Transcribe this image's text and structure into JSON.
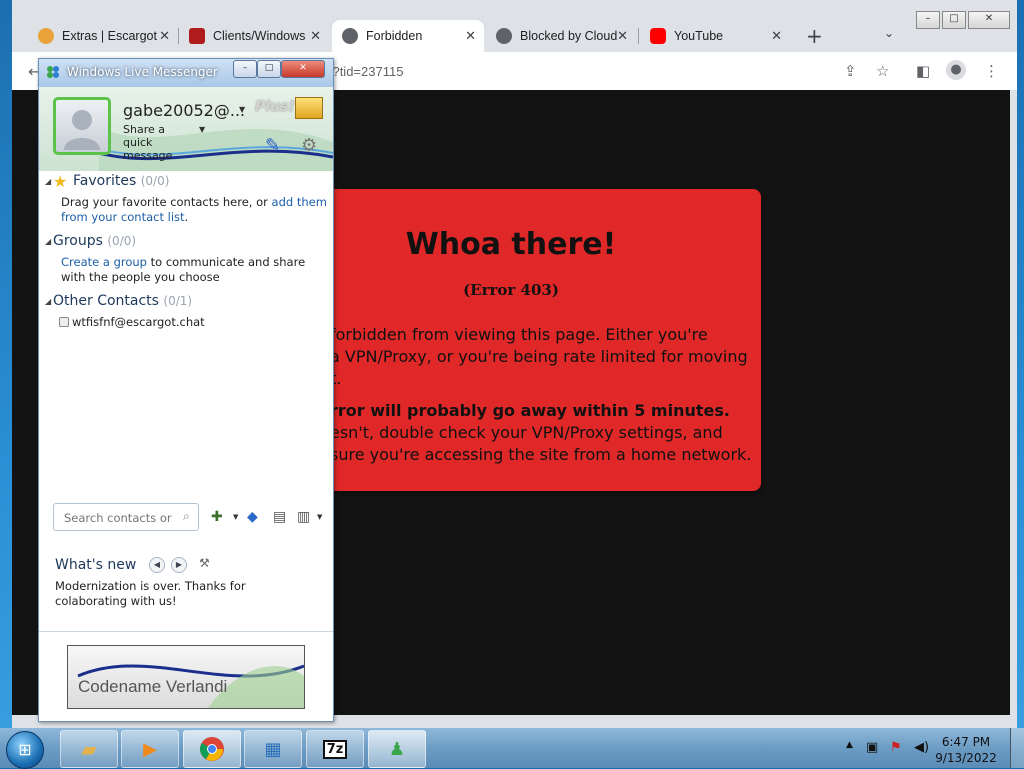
{
  "browser": {
    "tabs": [
      {
        "label": "Extras | Escargot",
        "favicon": "chrome-icon",
        "color": "#e8a33a"
      },
      {
        "label": "Clients/Windows",
        "favicon": "escargot-icon",
        "color": "#b01c1c"
      },
      {
        "label": "Forbidden",
        "favicon": "globe-icon",
        "color": "#5f6368",
        "active": true
      },
      {
        "label": "Blocked by Cloud",
        "favicon": "globe-icon",
        "color": "#5f6368"
      },
      {
        "label": "YouTube",
        "favicon": "youtube-icon",
        "color": "#ff0000"
      }
    ],
    "new_tab": "+",
    "url": "np?tid=237115"
  },
  "error_page": {
    "title": "Whoa there!",
    "code": "(Error 403)",
    "line1": "forbidden from viewing this page. Either you're",
    "line2": "a VPN/Proxy, or you're being rate limited for moving",
    "line3": "t.",
    "line4": "rror will probably go away within 5 minutes.",
    "line5": "esn't, double check your VPN/Proxy settings, and",
    "line6": "sure you're accessing the site from a home network.",
    "bg_color": "#e02828"
  },
  "messenger": {
    "window_title": "Windows Live Messenger",
    "username": "gabe20052@...",
    "quick_message": "Share a quick message",
    "plus_label": "Plus!",
    "sections": {
      "favorites": {
        "label": "Favorites",
        "count": "(0/0)",
        "desc": "Drag your favorite contacts here, or ",
        "link": "add them from your contact list",
        "after": "."
      },
      "groups": {
        "label": "Groups",
        "count": "(0/0)",
        "link": "Create a group",
        "desc": " to communicate and share with the people you choose"
      },
      "other": {
        "label": "Other Contacts",
        "count": "(0/1)"
      }
    },
    "contacts": [
      "wtfisfnf@escargot.chat"
    ],
    "search_placeholder": "Search contacts or ...",
    "whats_new": {
      "title": "What's new",
      "text": "Modernization is over. Thanks for colaborating with us!"
    },
    "ad_text": "Codename Verlandi"
  },
  "taskbar": {
    "clock_time": "6:47 PM",
    "clock_date": "9/13/2022"
  }
}
